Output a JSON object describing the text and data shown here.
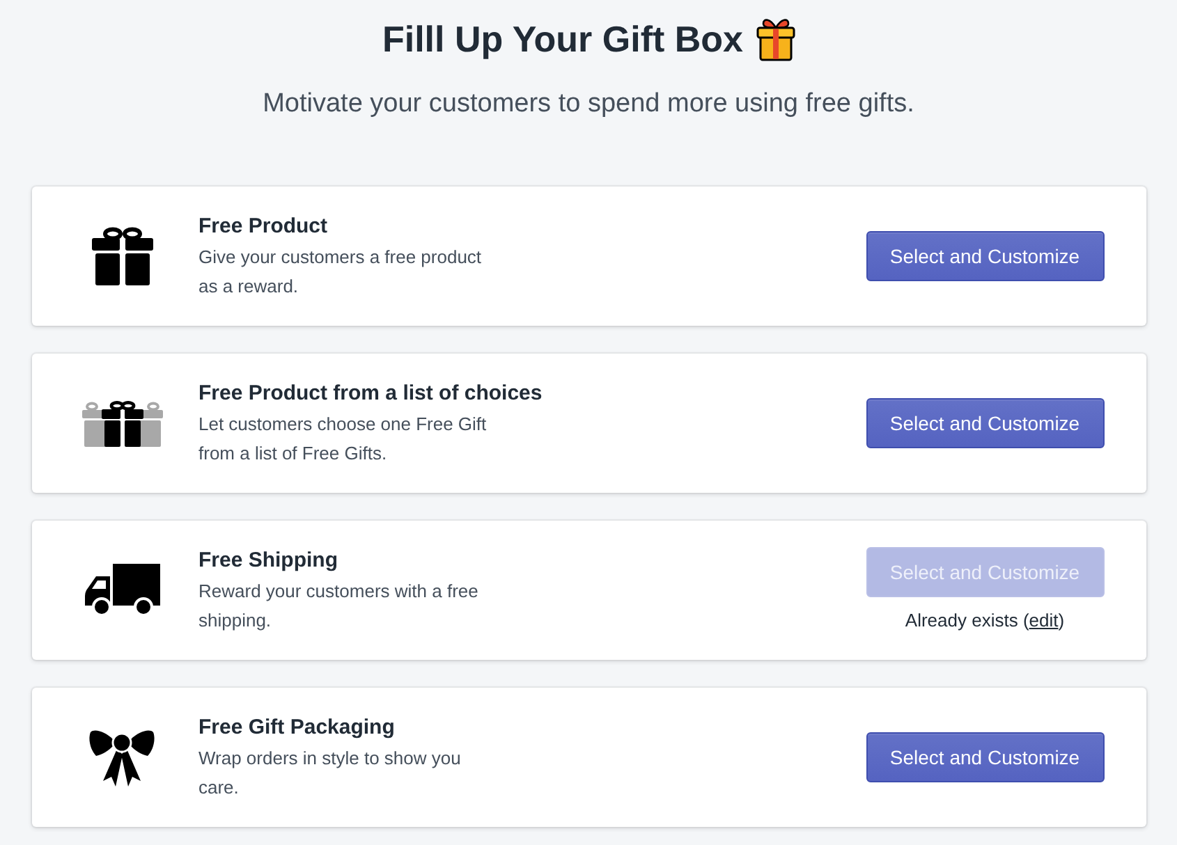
{
  "header": {
    "title": "Filll Up Your Gift Box",
    "subtitle": "Motivate your customers to spend more using free gifts."
  },
  "options": [
    {
      "kind": "gift",
      "title": "Free Product",
      "description": "Give your customers a free product as a reward.",
      "button": {
        "label": "Select and Customize",
        "disabled": false
      }
    },
    {
      "kind": "gift-choices",
      "title": "Free Product from a list of choices",
      "description": "Let customers choose one Free Gift from a list of Free Gifts.",
      "button": {
        "label": "Select and Customize",
        "disabled": false
      }
    },
    {
      "kind": "truck",
      "title": "Free Shipping",
      "description": "Reward your customers with a free shipping.",
      "button": {
        "label": "Select and Customize",
        "disabled": true
      },
      "note": {
        "before": "Already exists (",
        "link": "edit",
        "after": ")"
      }
    },
    {
      "kind": "bow",
      "title": "Free Gift Packaging",
      "description": "Wrap orders in style to show you care.",
      "button": {
        "label": "Select and Customize",
        "disabled": false
      }
    }
  ]
}
